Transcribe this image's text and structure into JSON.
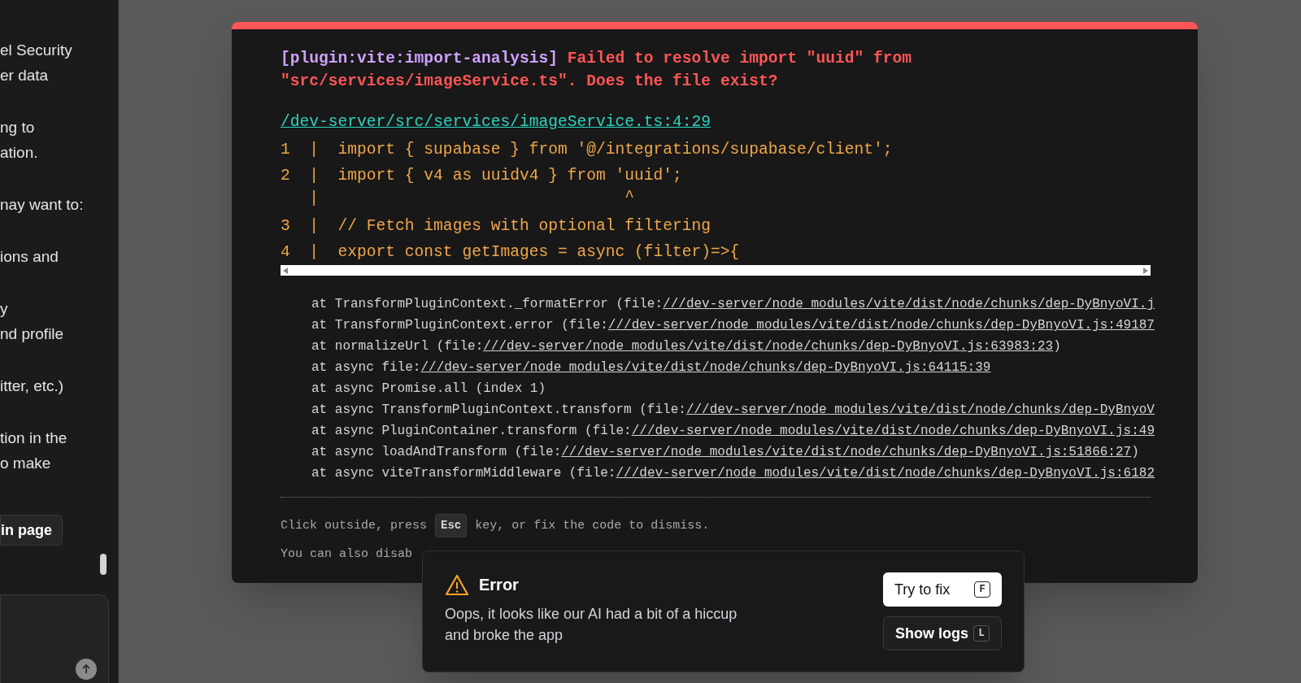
{
  "sidebar": {
    "paragraphs": [
      [
        "el Security",
        "er data"
      ],
      [
        "ng to",
        "ation."
      ],
      [
        "nay want to:"
      ],
      [
        "ions and"
      ],
      [
        "y",
        "nd profile"
      ],
      [
        "itter, etc.)"
      ],
      [
        "tion in the",
        "o make"
      ]
    ],
    "button": "in page"
  },
  "error_overlay": {
    "plugin": "[plugin:vite:import-analysis]",
    "message": "Failed to resolve import \"uuid\" from \"src/services/imageService.ts\". Does the file exist?",
    "file_link": "/dev-server/src/services/imageService.ts:4:29",
    "code_frame": [
      {
        "kind": "code",
        "number": "1",
        "pipe": "|",
        "code": "import { supabase } from '@/integrations/supabase/client';"
      },
      {
        "kind": "code",
        "number": "2",
        "pipe": "|",
        "code": "import { v4 as uuidv4 } from 'uuid';"
      },
      {
        "kind": "marker",
        "pipe": "|",
        "code": "^"
      },
      {
        "kind": "code",
        "number": "3",
        "pipe": "|",
        "code": "// Fetch images with optional filtering"
      },
      {
        "kind": "code",
        "number": "4",
        "pipe": "|",
        "code": "export const getImages = async (filter)=>{"
      }
    ],
    "stack": [
      {
        "prefix": "at TransformPluginContext._formatError (file:",
        "link": "///dev-server/node_modules/vite/dist/node/chunks/dep-DyBnyoVI.j"
      },
      {
        "prefix": "at TransformPluginContext.error (file:",
        "link": "///dev-server/node_modules/vite/dist/node/chunks/dep-DyBnyoVI.js:49187"
      },
      {
        "prefix": "at normalizeUrl (file:",
        "link": "///dev-server/node_modules/vite/dist/node/chunks/dep-DyBnyoVI.js:63983:23",
        "suffix": ")"
      },
      {
        "prefix": "at async file:",
        "link": "///dev-server/node_modules/vite/dist/node/chunks/dep-DyBnyoVI.js:64115:39"
      },
      {
        "prefix": "at async Promise.all (index 1)"
      },
      {
        "prefix": "at async TransformPluginContext.transform (file:",
        "link": "///dev-server/node_modules/vite/dist/node/chunks/dep-DyBnyoV"
      },
      {
        "prefix": "at async PluginContainer.transform (file:",
        "link": "///dev-server/node_modules/vite/dist/node/chunks/dep-DyBnyoVI.js:49"
      },
      {
        "prefix": "at async loadAndTransform (file:",
        "link": "///dev-server/node_modules/vite/dist/node/chunks/dep-DyBnyoVI.js:51866:27",
        "suffix": ")"
      },
      {
        "prefix": "at async viteTransformMiddleware (file:",
        "link": "///dev-server/node_modules/vite/dist/node/chunks/dep-DyBnyoVI.js:6182"
      }
    ],
    "tip_before": "Click outside, press",
    "tip_key": "Esc",
    "tip_after": "key, or fix the code to dismiss.",
    "tip_2": "You can also disab"
  },
  "toast": {
    "title": "Error",
    "message": "Oops, it looks like our AI had a bit of a hiccup and broke the app",
    "buttons": [
      {
        "kind": "primary",
        "label": "Try to fix",
        "key": "F"
      },
      {
        "kind": "secondary",
        "label": "Show logs",
        "key": "L"
      }
    ]
  }
}
